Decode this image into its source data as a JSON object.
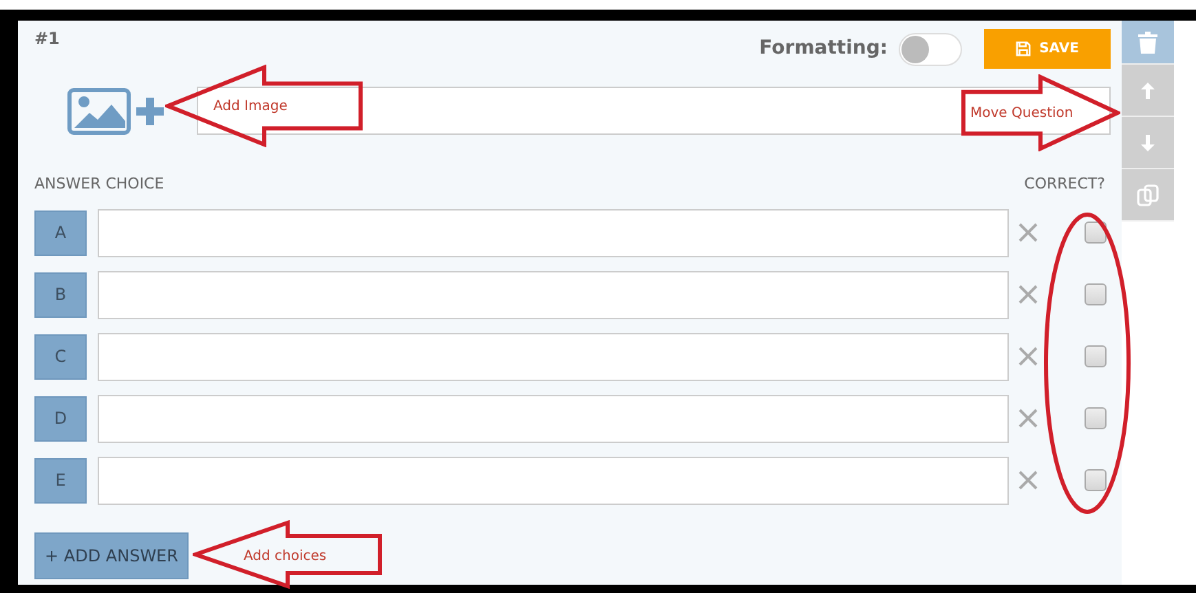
{
  "question": {
    "number": "#1"
  },
  "formatting": {
    "label": "Formatting:",
    "on": false
  },
  "save_button": {
    "label": "SAVE"
  },
  "answer_header": "ANSWER CHOICE",
  "correct_header": "CORRECT?",
  "choices": [
    {
      "letter": "A",
      "correct": false
    },
    {
      "letter": "B",
      "correct": false
    },
    {
      "letter": "C",
      "correct": false
    },
    {
      "letter": "D",
      "correct": false
    },
    {
      "letter": "E",
      "correct": false
    }
  ],
  "add_button": {
    "label": "+ ADD ANSWER"
  },
  "annotations": [
    {
      "kind": "arrow-left",
      "text": "Add Image"
    },
    {
      "kind": "arrow-right",
      "text": "Move Question"
    },
    {
      "kind": "arrow-left",
      "text": "Add choices"
    },
    {
      "kind": "ellipse"
    }
  ]
}
